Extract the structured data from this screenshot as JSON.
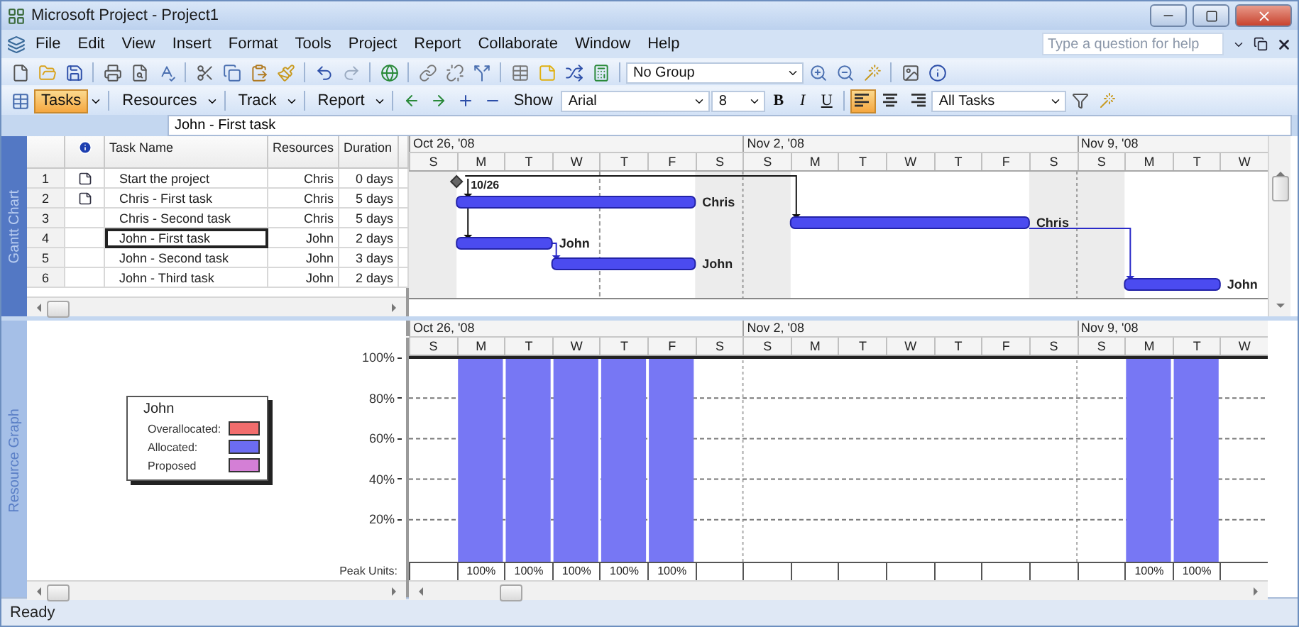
{
  "window": {
    "title": "Microsoft Project - Project1"
  },
  "menu": [
    "File",
    "Edit",
    "View",
    "Insert",
    "Format",
    "Tools",
    "Project",
    "Report",
    "Collaborate",
    "Window",
    "Help"
  ],
  "help_box": {
    "placeholder": "Type a question for help"
  },
  "standard_toolbar": {
    "group_combo": "No Group"
  },
  "guide_toolbar": {
    "buttons": [
      {
        "label": "Tasks",
        "selected": true
      },
      {
        "label": "Resources",
        "selected": false
      },
      {
        "label": "Track",
        "selected": false
      },
      {
        "label": "Report",
        "selected": false
      }
    ]
  },
  "formatting_toolbar": {
    "show": "Show",
    "font": "Arial",
    "size": "8",
    "styles": [
      "B",
      "I",
      "U"
    ],
    "align": [
      {
        "selected": true
      },
      {
        "selected": false
      },
      {
        "selected": false
      }
    ],
    "filter": "All Tasks"
  },
  "entry_bar": {
    "value": "John - First task"
  },
  "gantt": {
    "view_label": "Gantt Chart",
    "columns": [
      "Task Name",
      "Resources",
      "Duration"
    ],
    "rows": [
      {
        "id": "1",
        "indicator": true,
        "name": "Start the project",
        "resources": "Chris",
        "duration": "0 days",
        "selected": false,
        "kind": "milestone",
        "bar_label": "10/26"
      },
      {
        "id": "2",
        "indicator": true,
        "name": "Chris - First task",
        "resources": "Chris",
        "duration": "5 days",
        "selected": false,
        "kind": "task",
        "bar_label": "Chris"
      },
      {
        "id": "3",
        "indicator": false,
        "name": "Chris - Second task",
        "resources": "Chris",
        "duration": "5 days",
        "selected": false,
        "kind": "task",
        "bar_label": "Chris"
      },
      {
        "id": "4",
        "indicator": false,
        "name": "John - First task",
        "resources": "John",
        "duration": "2 days",
        "selected": true,
        "kind": "task",
        "bar_label": "John"
      },
      {
        "id": "5",
        "indicator": false,
        "name": "John - Second task",
        "resources": "John",
        "duration": "3 days",
        "selected": false,
        "kind": "task",
        "bar_label": "John"
      },
      {
        "id": "6",
        "indicator": false,
        "name": "John - Third task",
        "resources": "John",
        "duration": "2 days",
        "selected": false,
        "kind": "task",
        "bar_label": "John"
      }
    ],
    "timescale": {
      "weeks": [
        "Oct 26, '08",
        "Nov 2, '08",
        "Nov 9, '08"
      ],
      "days": [
        "S",
        "M",
        "T",
        "W",
        "T",
        "F",
        "S",
        "S",
        "M",
        "T",
        "W",
        "T",
        "F",
        "S",
        "S",
        "M",
        "T",
        "W"
      ]
    }
  },
  "resource_graph": {
    "view_label": "Resource Graph",
    "legend": {
      "title": "John",
      "items": [
        {
          "label": "Overallocated:",
          "color": "#f26d6d"
        },
        {
          "label": "Allocated:",
          "color": "#6c6cf2"
        },
        {
          "label": "Proposed",
          "color": "#d47fd6"
        }
      ]
    },
    "peak_label": "Peak Units:",
    "weeks": [
      "Oct 26, '08",
      "Nov 2, '08",
      "Nov 9, '08"
    ],
    "chart_data": {
      "type": "bar",
      "categories": [
        "S",
        "M",
        "T",
        "W",
        "T",
        "F",
        "S",
        "S",
        "M",
        "T",
        "W",
        "T",
        "F",
        "S",
        "S",
        "M",
        "T",
        "W"
      ],
      "values": [
        0,
        100,
        100,
        100,
        100,
        100,
        0,
        0,
        0,
        0,
        0,
        0,
        0,
        0,
        0,
        100,
        100,
        0
      ],
      "ylim": [
        0,
        100
      ],
      "grid": true,
      "yticks": [
        {
          "value": 20,
          "label": "20%"
        },
        {
          "value": 40,
          "label": "40%"
        },
        {
          "value": 60,
          "label": "60%"
        },
        {
          "value": 80,
          "label": "80%"
        },
        {
          "value": 100,
          "label": "100%"
        }
      ],
      "value_labels": [
        null,
        "100%",
        "100%",
        "100%",
        "100%",
        "100%",
        null,
        null,
        null,
        null,
        null,
        null,
        null,
        null,
        null,
        "100%",
        "100%",
        null
      ]
    }
  },
  "status_bar": "Ready"
}
